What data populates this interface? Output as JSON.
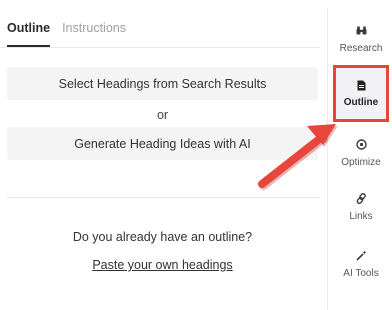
{
  "tabs": {
    "outline": "Outline",
    "instructions": "Instructions"
  },
  "main": {
    "select_headings_btn": "Select Headings from Search Results",
    "or_label": "or",
    "generate_ideas_btn": "Generate Heading Ideas with AI",
    "question": "Do you already have an outline?",
    "paste_link": "Paste your own headings"
  },
  "sidebar": {
    "items": [
      {
        "label": "Research",
        "icon": "binoculars-icon"
      },
      {
        "label": "Outline",
        "icon": "document-icon",
        "active": true
      },
      {
        "label": "Optimize",
        "icon": "target-icon"
      },
      {
        "label": "Links",
        "icon": "link-icon"
      },
      {
        "label": "AI Tools",
        "icon": "magic-wand-icon"
      }
    ]
  },
  "colors": {
    "highlight_red": "#e8453c",
    "arrow_red": "#e8453c",
    "tab_active": "#2b2b2b"
  }
}
